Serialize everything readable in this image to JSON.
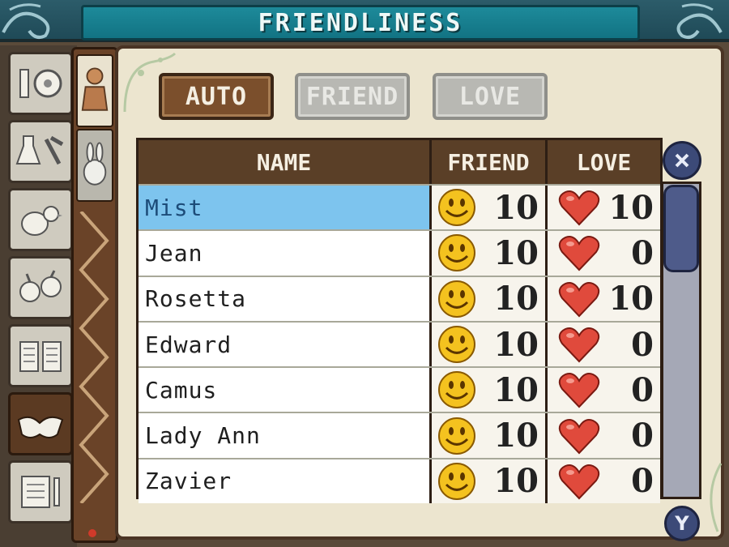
{
  "window": {
    "title": "FRIENDLINESS"
  },
  "filters": [
    {
      "label": "AUTO",
      "active": true
    },
    {
      "label": "FRIEND",
      "active": false
    },
    {
      "label": "LOVE",
      "active": false
    }
  ],
  "table": {
    "columns": [
      "NAME",
      "FRIEND",
      "LOVE"
    ],
    "rows": [
      {
        "name": "Mist",
        "friend": "10",
        "love": "10",
        "selected": true
      },
      {
        "name": "Jean",
        "friend": "10",
        "love": "0"
      },
      {
        "name": "Rosetta",
        "friend": "10",
        "love": "10"
      },
      {
        "name": "Edward",
        "friend": "10",
        "love": "0"
      },
      {
        "name": "Camus",
        "friend": "10",
        "love": "0"
      },
      {
        "name": "Lady Ann",
        "friend": "10",
        "love": "0"
      },
      {
        "name": "Zavier",
        "friend": "10",
        "love": "0"
      }
    ]
  },
  "buttons": {
    "close_icon": "close-icon",
    "y_label": "Y"
  },
  "sidebar_tabs": [
    "tools-tab",
    "items-tab",
    "animals-tab",
    "crops-tab",
    "books-tab",
    "friendliness-tab",
    "records-tab"
  ],
  "colors": {
    "selected_row": "#7dc4ee",
    "title_plate": "#1d8a9a",
    "scrollbar": "#4e5b8a"
  }
}
